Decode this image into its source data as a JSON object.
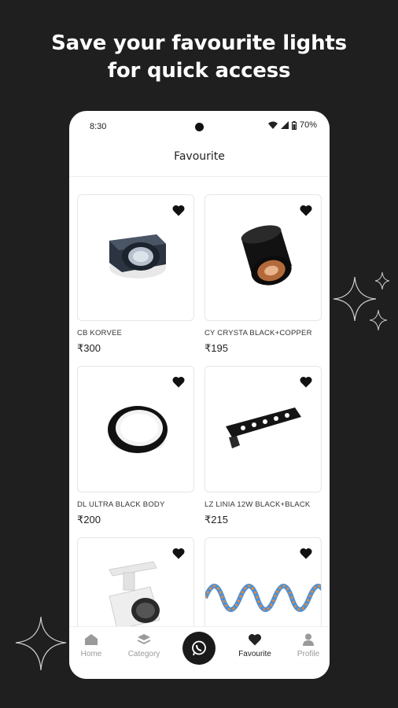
{
  "headline": {
    "line1": "Save your favourite lights",
    "line2": "for quick access"
  },
  "status_bar": {
    "time": "8:30",
    "battery": "70%"
  },
  "app_bar": {
    "title": "Favourite"
  },
  "products": [
    {
      "name": "CB KORVEE",
      "price": "₹300"
    },
    {
      "name": "CY CRYSTA BLACK+COPPER",
      "price": "₹195"
    },
    {
      "name": "DL ULTRA BLACK BODY",
      "price": "₹200"
    },
    {
      "name": "LZ LINIA 12W BLACK+BLACK",
      "price": "₹215"
    },
    {
      "name": "",
      "price": ""
    },
    {
      "name": "",
      "price": ""
    }
  ],
  "bottom_nav": {
    "home": "Home",
    "category": "Category",
    "favourite": "Favourite",
    "profile": "Profile"
  },
  "colors": {
    "background": "#1f1f1f",
    "card_border": "#e6e6e6",
    "active": "#222222",
    "inactive": "#9a9a9a"
  }
}
